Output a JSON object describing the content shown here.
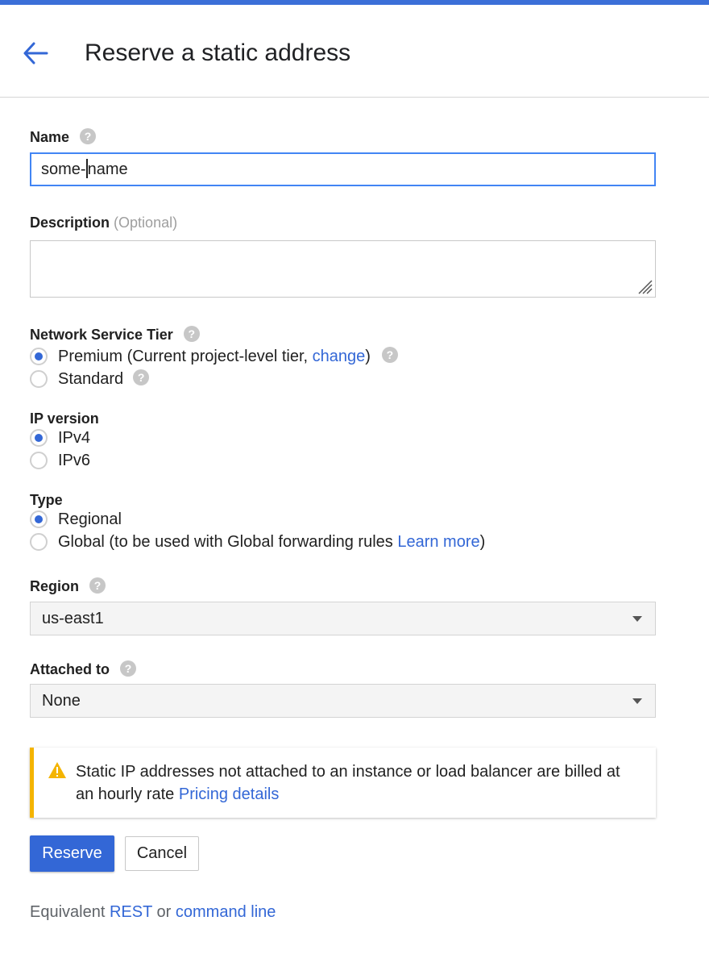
{
  "header": {
    "title": "Reserve a static address",
    "back_icon": "arrow-left-icon"
  },
  "colors": {
    "accent": "#3367d6",
    "warning": "#f4b400"
  },
  "name_field": {
    "label": "Name",
    "value_before_caret": "some-",
    "value_after_caret": "name"
  },
  "description_field": {
    "label": "Description",
    "optional": "(Optional)",
    "value": ""
  },
  "network_tier": {
    "label": "Network Service Tier",
    "options": [
      {
        "label_prefix": "Premium (Current project-level tier, ",
        "link": "change",
        "label_suffix": ")",
        "checked": true
      },
      {
        "label": "Standard",
        "checked": false
      }
    ]
  },
  "ip_version": {
    "label": "IP version",
    "options": [
      {
        "label": "IPv4",
        "checked": true
      },
      {
        "label": "IPv6",
        "checked": false
      }
    ]
  },
  "type": {
    "label": "Type",
    "options": [
      {
        "label": "Regional",
        "checked": true
      },
      {
        "label_prefix": "Global (to be used with Global forwarding rules ",
        "link": "Learn more",
        "label_suffix": ")",
        "checked": false
      }
    ]
  },
  "region": {
    "label": "Region",
    "selected": "us-east1"
  },
  "attached_to": {
    "label": "Attached to",
    "selected": "None"
  },
  "warning": {
    "icon": "warning-icon",
    "text": "Static IP addresses not attached to an instance or load balancer are billed at an hourly rate",
    "link": "Pricing details"
  },
  "actions": {
    "reserve": "Reserve",
    "cancel": "Cancel"
  },
  "footer": {
    "prefix": "Equivalent",
    "rest_link": "REST",
    "or": "or",
    "cli_link": "command line"
  },
  "help_glyph": "?"
}
